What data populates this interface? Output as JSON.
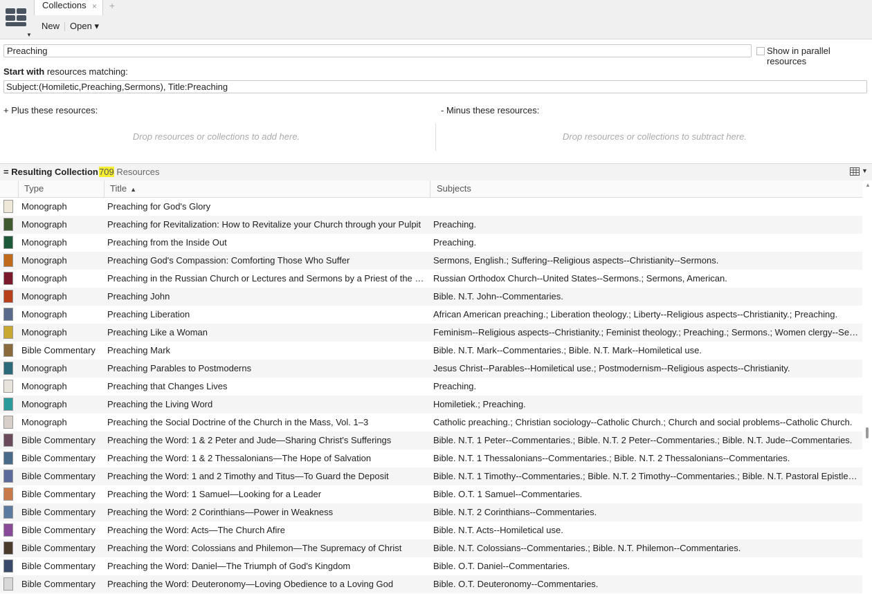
{
  "app": {
    "menu_icon": "logos-library-icon"
  },
  "tabs": [
    {
      "label": "Collections",
      "close": "×"
    }
  ],
  "tab_add": "+",
  "toolbar": {
    "new_label": "New",
    "open_label": "Open",
    "open_caret": "▾"
  },
  "collection": {
    "name_value": "Preaching",
    "parallel_label": "Show in parallel resources",
    "parallel_checked": false,
    "start_bold": "Start with",
    "start_rest": " resources matching:",
    "query_value": "Subject:(Homiletic,Preaching,Sermons), Title:Preaching",
    "plus_label": "+  Plus these resources:",
    "minus_label": "-  Minus these resources:",
    "plus_drop": "Drop resources or collections to add here.",
    "minus_drop": "Drop resources or collections to subtract here."
  },
  "result": {
    "title": "= Resulting Collection",
    "count": "709",
    "count_suffix": " Resources",
    "view_icon": "column-view-icon"
  },
  "table": {
    "columns": [
      "Type",
      "Title",
      "Subjects"
    ],
    "sort_column": "Title",
    "sort_dir": "▲",
    "rows": [
      {
        "type": "Monograph",
        "title": "Preaching for God's Glory",
        "subjects": "",
        "cover": "#efe8d8"
      },
      {
        "type": "Monograph",
        "title": "Preaching for Revitalization: How to Revitalize your Church through your Pulpit",
        "subjects": "Preaching.",
        "cover": "#3f5a2e"
      },
      {
        "type": "Monograph",
        "title": "Preaching from the Inside Out",
        "subjects": "Preaching.",
        "cover": "#1d5a3a"
      },
      {
        "type": "Monograph",
        "title": "Preaching God's Compassion: Comforting Those Who Suffer",
        "subjects": "Sermons, English.; Suffering--Religious aspects--Christianity--Sermons.",
        "cover": "#c06a1a"
      },
      {
        "type": "Monograph",
        "title": "Preaching in the Russian Church or Lectures and Sermons by a Priest of the Holy Orthodox Church",
        "subjects": "Russian Orthodox Church--United States--Sermons.; Sermons, American.",
        "cover": "#7a1a2a"
      },
      {
        "type": "Monograph",
        "title": "Preaching John",
        "subjects": "Bible. N.T. John--Commentaries.",
        "cover": "#b8401a"
      },
      {
        "type": "Monograph",
        "title": "Preaching Liberation",
        "subjects": "African American preaching.; Liberation theology.; Liberty--Religious aspects--Christianity.; Preaching.",
        "cover": "#5a6a8a"
      },
      {
        "type": "Monograph",
        "title": "Preaching Like a Woman",
        "subjects": "Feminism--Religious aspects--Christianity.; Feminist theology.; Preaching.; Sermons.; Women clergy--Sermons.",
        "cover": "#c8a830"
      },
      {
        "type": "Bible Commentary",
        "title": "Preaching Mark",
        "subjects": "Bible. N.T. Mark--Commentaries.; Bible. N.T. Mark--Homiletical use.",
        "cover": "#8a6a3a"
      },
      {
        "type": "Monograph",
        "title": "Preaching Parables to Postmoderns",
        "subjects": "Jesus Christ--Parables--Homiletical use.; Postmodernism--Religious aspects--Christianity.",
        "cover": "#2a6a7a"
      },
      {
        "type": "Monograph",
        "title": "Preaching that Changes Lives",
        "subjects": "Preaching.",
        "cover": "#e8e4dc"
      },
      {
        "type": "Monograph",
        "title": "Preaching the Living Word",
        "subjects": "Homiletiek.; Preaching.",
        "cover": "#2a9a9a"
      },
      {
        "type": "Monograph",
        "title": "Preaching the Social Doctrine of the Church in the Mass, Vol. 1–3",
        "subjects": "Catholic preaching.; Christian sociology--Catholic Church.; Church and social problems--Catholic Church.",
        "cover": "#d8d0c8"
      },
      {
        "type": "Bible Commentary",
        "title": "Preaching the Word: 1 & 2 Peter and Jude—Sharing Christ's Sufferings",
        "subjects": "Bible. N.T. 1 Peter--Commentaries.; Bible. N.T. 2 Peter--Commentaries.; Bible. N.T. Jude--Commentaries.",
        "cover": "#6a4a5a"
      },
      {
        "type": "Bible Commentary",
        "title": "Preaching the Word: 1 & 2 Thessalonians—The Hope of Salvation",
        "subjects": "Bible. N.T. 1 Thessalonians--Commentaries.; Bible. N.T. 2 Thessalonians--Commentaries.",
        "cover": "#4a6a8a"
      },
      {
        "type": "Bible Commentary",
        "title": "Preaching the Word: 1 and 2 Timothy and Titus—To Guard the Deposit",
        "subjects": "Bible. N.T. 1 Timothy--Commentaries.; Bible. N.T. 2 Timothy--Commentaries.; Bible. N.T. Pastoral Epistles--Commentaries.",
        "cover": "#5a6a9a"
      },
      {
        "type": "Bible Commentary",
        "title": "Preaching the Word: 1 Samuel—Looking for a Leader",
        "subjects": "Bible. O.T. 1 Samuel--Commentaries.",
        "cover": "#c87a4a"
      },
      {
        "type": "Bible Commentary",
        "title": "Preaching the Word: 2 Corinthians—Power in Weakness",
        "subjects": "Bible. N.T. 2 Corinthians--Commentaries.",
        "cover": "#5a7aa0"
      },
      {
        "type": "Bible Commentary",
        "title": "Preaching the Word: Acts—The Church Afire",
        "subjects": "Bible. N.T. Acts--Homiletical use.",
        "cover": "#8a4a9a"
      },
      {
        "type": "Bible Commentary",
        "title": "Preaching the Word: Colossians and Philemon—The Supremacy of Christ",
        "subjects": "Bible. N.T. Colossians--Commentaries.; Bible. N.T. Philemon--Commentaries.",
        "cover": "#4a3a2a"
      },
      {
        "type": "Bible Commentary",
        "title": "Preaching the Word: Daniel—The Triumph of God's Kingdom",
        "subjects": "Bible. O.T. Daniel--Commentaries.",
        "cover": "#3a4a6a"
      },
      {
        "type": "Bible Commentary",
        "title": "Preaching the Word: Deuteronomy—Loving Obedience to a Loving God",
        "subjects": "Bible. O.T. Deuteronomy--Commentaries.",
        "cover": "#d8d8d8"
      }
    ]
  }
}
